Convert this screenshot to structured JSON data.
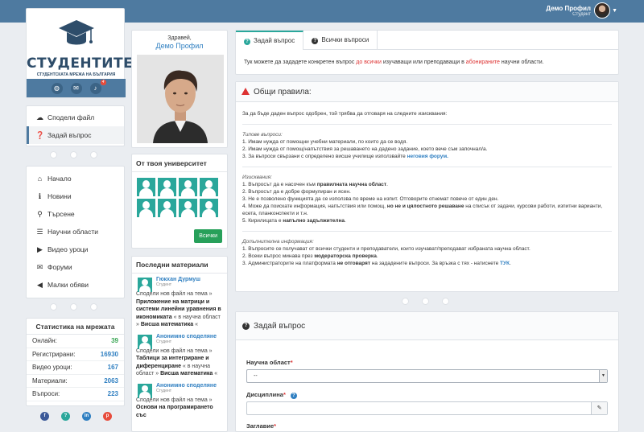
{
  "header": {
    "user_name": "Демо Профил",
    "user_role": "Студент"
  },
  "logo": {
    "title": "СТУДЕНТИТЕ",
    "subtitle": "СТУДЕНТСКАТА МРЕЖА НА БЪЛГАРИЯ",
    "notification_count": "4"
  },
  "actions": [
    {
      "label": "Сподели файл",
      "icon": "cloud-upload-icon",
      "glyph": "☁"
    },
    {
      "label": "Задай въпрос",
      "icon": "question-icon",
      "glyph": "?"
    }
  ],
  "nav": [
    {
      "label": "Начало",
      "icon": "home-icon",
      "glyph": "⌂"
    },
    {
      "label": "Новини",
      "icon": "info-icon",
      "glyph": "ℹ"
    },
    {
      "label": "Търсене",
      "icon": "search-icon",
      "glyph": "⚲"
    },
    {
      "label": "Научни области",
      "icon": "list-icon",
      "glyph": "☰"
    },
    {
      "label": "Видео уроци",
      "icon": "video-icon",
      "glyph": "▶"
    },
    {
      "label": "Форуми",
      "icon": "forum-icon",
      "glyph": "✉"
    },
    {
      "label": "Малки обяви",
      "icon": "bullhorn-icon",
      "glyph": "◀"
    }
  ],
  "stats": {
    "title": "Статистика на мрежата",
    "rows": [
      {
        "label": "Онлайн:",
        "value": "39"
      },
      {
        "label": "Регистрирани:",
        "value": "16930"
      },
      {
        "label": "Видео уроци:",
        "value": "167"
      },
      {
        "label": "Материали:",
        "value": "2063"
      },
      {
        "label": "Въпроси:",
        "value": "223"
      }
    ]
  },
  "social": [
    {
      "icon": "facebook-icon",
      "glyph": "f",
      "color": "#3b5998"
    },
    {
      "icon": "google-plus-icon",
      "glyph": "g",
      "color": "#2aa79b"
    },
    {
      "icon": "linkedin-icon",
      "glyph": "in",
      "color": "#2f7fc1"
    },
    {
      "icon": "pinterest-icon",
      "glyph": "p",
      "color": "#e74c3c"
    }
  ],
  "profile": {
    "greeting": "Здравей,",
    "name": "Демо Профил"
  },
  "university": {
    "title": "От твоя университет",
    "button": "Всички"
  },
  "latest": {
    "title": "Последни материали",
    "items": [
      {
        "name": "Гюкхан Дурмуш",
        "role": "Студент",
        "pre": "Сподели нов файл на тема »",
        "topic": "Приложение на матрици и системи линейни уравнения в икономиката",
        "mid": "« в научна област »",
        "area": "Висша математика",
        "post": "«"
      },
      {
        "name": "Анонимно споделяне",
        "role": "Студент",
        "pre": "Сподели нов файл на тема »",
        "topic": "Таблици за интегриране и диференциране",
        "mid": "« в научна област »",
        "area": "Висша математика",
        "post": "«"
      },
      {
        "name": "Анонимно споделяне",
        "role": "Студент",
        "pre": "Сподели нов файл на тема »",
        "topic": "Основи на програмирането със",
        "mid": "",
        "area": "",
        "post": ""
      }
    ]
  },
  "tabs": {
    "ask": "Задай въпрос",
    "all": "Всички въпроси",
    "msg_pre": "Тук можете да зададете конкретен въпрос ",
    "msg_red1": "до всички",
    "msg_mid": " изучаващи или преподаващи в ",
    "msg_red2": "абонираните",
    "msg_post": " научни области."
  },
  "rules": {
    "title": "Общи правила:",
    "intro": "За да бъде даден въпрос одобрен, той трябва да отговаря на следните изисквания:",
    "types_title": "Типове въпроси:",
    "types": [
      "1. Имам нужда от помощни учебни материали, по които да се водя.",
      "2. Имам нужда от помощ/напътствия за решаването на дадено задание, което вече съм започнал/а.",
      "3. За въпроси свързани с определено висше училище използвайте "
    ],
    "forum_link": "неговия форум.",
    "req_title": "Изисквания:",
    "req1_pre": "1. Въпросът да е насочен към ",
    "req1_bold": "правилната научна област",
    "req1_post": ".",
    "req2": "2. Въпросът да е добре формулиран и ясен.",
    "req3": "3. Не е позволено функцията да се използва по време на изпит. Отговорите отнемат повече от един ден.",
    "req4_pre": "4. Може да поискате информация, напътствия или помощ, ",
    "req4_bold": "но не и цялостното решаване",
    "req4_post": " на списък от задачи, курсови работи, изпитни варианти, есета, планконспекти и т.н.",
    "req5_pre": "5. Кирилицата е ",
    "req5_bold": "напълно задължителна",
    "req5_post": ".",
    "info_title": "Допълнителна информация:",
    "info1": "1. Въпросите се получават от всички студенти и преподаватели, които изучават/преподават избраната научна област.",
    "info2_pre": "2. Всеки въпрос минава през ",
    "info2_bold": "модераторска проверка",
    "info2_post": ".",
    "info3_pre": "3. Администраторите на платформата ",
    "info3_bold": "не отговарят",
    "info3_mid": " на зададените въпроси. За връзка с тях - натиснете ",
    "info3_link": "ТУК",
    "info3_post": "."
  },
  "form": {
    "title": "Задай въпрос",
    "field1_label": "Научна област",
    "field1_value": "--",
    "field2_label": "Дисциплина",
    "field3_label": "Заглавие",
    "required_mark": "*"
  }
}
